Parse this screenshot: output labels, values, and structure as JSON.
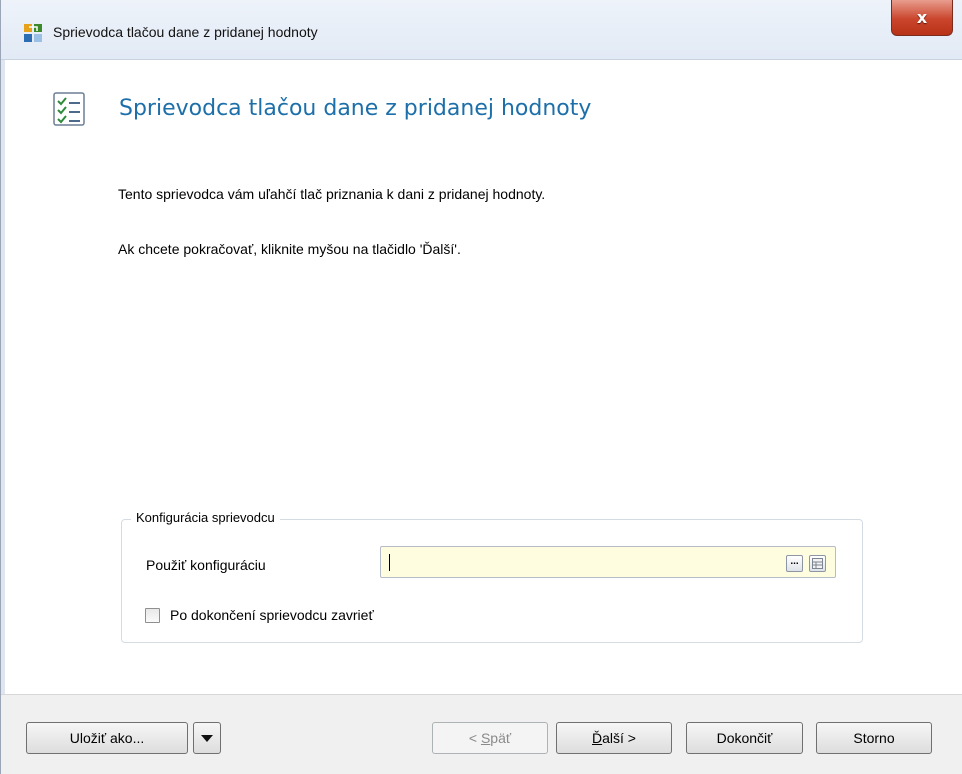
{
  "window": {
    "title": "Sprievodca tlačou dane z pridanej hodnoty",
    "close_label": "x"
  },
  "header": {
    "title": "Sprievodca tlačou dane z pridanej hodnoty",
    "icon": "checklist-icon"
  },
  "body": {
    "intro": "Tento sprievodca vám uľahčí tlač priznania k dani z pridanej hodnoty.",
    "instruction": "Ak chcete pokračovať, kliknite myšou na tlačidlo 'Ďalší'."
  },
  "config_group": {
    "legend": "Konfigurácia sprievodcu",
    "use_config_label": "Použiť konfiguráciu",
    "use_config_value": "",
    "browse_icon": "ellipsis-icon",
    "table_icon": "table-icon",
    "close_after_finish_label": "Po dokončení sprievodcu zavrieť",
    "close_after_finish_checked": false
  },
  "buttons": {
    "save_as": "Uložiť ako...",
    "back": "< Späť",
    "back_prefix": "< ",
    "back_access": "S",
    "back_rest": "päť",
    "next_access": "Ď",
    "next_rest": "alší >",
    "next": "Ďalší >",
    "finish": "Dokončiť",
    "cancel": "Storno"
  }
}
